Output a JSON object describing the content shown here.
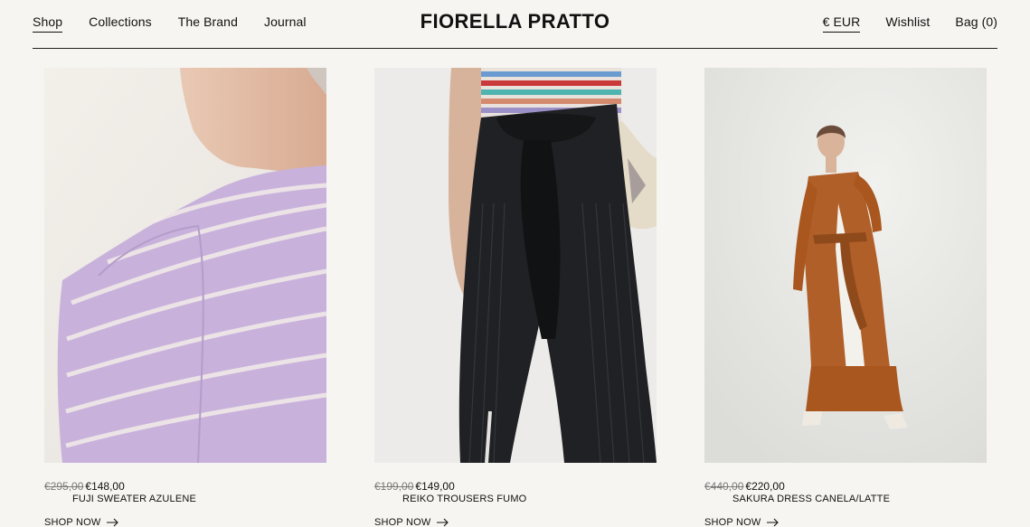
{
  "nav": {
    "left": [
      "Shop",
      "Collections",
      "The Brand",
      "Journal"
    ],
    "right": [
      "€ EUR",
      "Wishlist",
      "Bag (0)"
    ]
  },
  "brand": "FIORELLA PRATTO",
  "products": [
    {
      "old_price": "€295,00",
      "price": "€148,00",
      "name": "FUJI SWEATER AZULENE",
      "cta": "SHOP NOW",
      "image": "lilac-striped-sweater-shoulder"
    },
    {
      "old_price": "€199,00",
      "price": "€149,00",
      "name": "REIKO TROUSERS FUMO",
      "cta": "SHOP NOW",
      "image": "black-ribbed-trousers"
    },
    {
      "old_price": "€440,00",
      "price": "€220,00",
      "name": "SAKURA DRESS CANELA/LATTE",
      "cta": "SHOP NOW",
      "image": "rust-cream-knit-dress"
    }
  ],
  "colors": {
    "background": "#f6f5f1",
    "text": "#111111",
    "strike_price": "#7a7a7a"
  }
}
